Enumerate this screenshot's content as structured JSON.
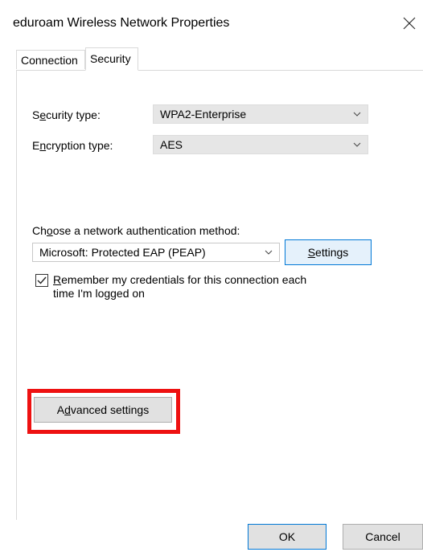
{
  "window": {
    "title": "eduroam Wireless Network Properties"
  },
  "tabs": [
    {
      "label": "Connection"
    },
    {
      "label": "Security"
    }
  ],
  "security": {
    "security_type": {
      "label_pre": "S",
      "label_accel": "e",
      "label_post": "curity type:",
      "value": "WPA2-Enterprise"
    },
    "encryption_type": {
      "label_pre": "E",
      "label_accel": "n",
      "label_post": "cryption type:",
      "value": "AES"
    },
    "auth_method": {
      "label_pre": "Ch",
      "label_accel": "o",
      "label_post": "ose a network authentication method:",
      "value": "Microsoft: Protected EAP (PEAP)"
    },
    "settings_button": {
      "accel": "S",
      "rest": "ettings"
    },
    "remember_credentials": {
      "checked": true,
      "line1_accel": "R",
      "line1_rest": "emember my credentials for this connection each",
      "line2": "time I'm logged on"
    },
    "advanced_button": {
      "pre": "A",
      "accel": "d",
      "post": "vanced settings"
    }
  },
  "footer": {
    "ok_label": "OK",
    "cancel_label": "Cancel"
  },
  "colors": {
    "highlight": "#ee1111",
    "accent": "#0078d7"
  },
  "icons": {
    "close": "close-icon",
    "dropdown": "chevron-down-icon",
    "check": "checkmark-icon"
  }
}
